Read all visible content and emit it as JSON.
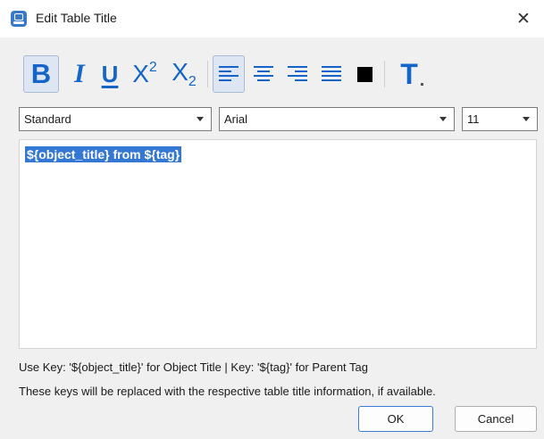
{
  "window": {
    "title": "Edit Table Title",
    "app_icon": "app-icon",
    "close_glyph": "✕"
  },
  "toolbar": {
    "bold_label": "B",
    "italic_label": "I",
    "underline_label": "U",
    "superscript_base": "X",
    "superscript_exp": "2",
    "subscript_base": "X",
    "subscript_exp": "2",
    "font_style_label": "T",
    "accent_color": "#1565c8",
    "text_color": "#000000",
    "active_alignment": "left"
  },
  "selectors": {
    "style": "Standard",
    "font": "Arial",
    "size": "11"
  },
  "editor": {
    "text": "${object_title} from ${tag}",
    "selection_color": "#3478d4"
  },
  "hints": {
    "keys": "Use Key: '${object_title}' for Object Title | Key: '${tag}' for Parent Tag",
    "note": "These keys will be replaced with the respective table title information, if available."
  },
  "buttons": {
    "ok": "OK",
    "cancel": "Cancel"
  }
}
